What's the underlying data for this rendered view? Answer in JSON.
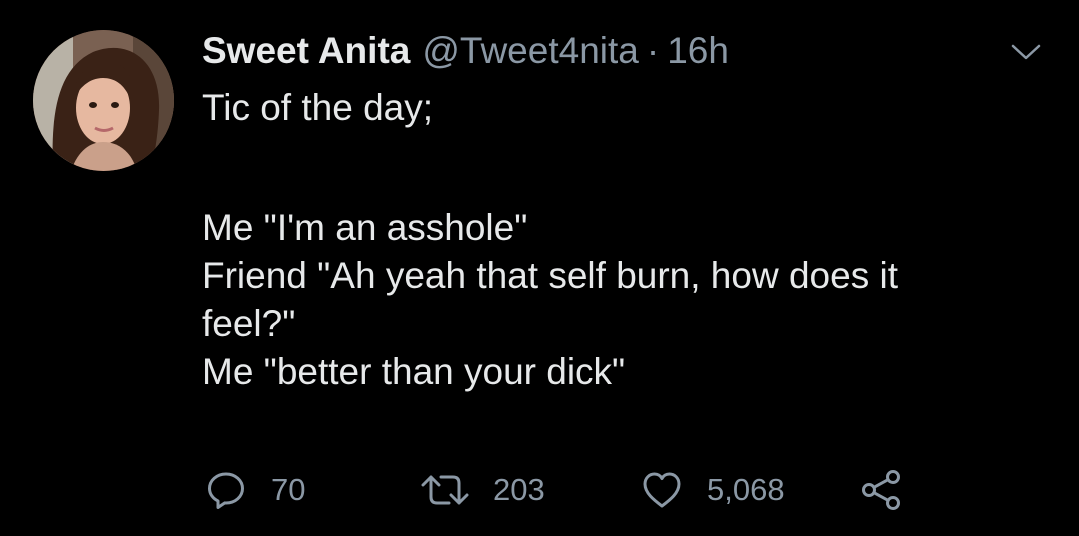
{
  "author": {
    "display_name": "Sweet Anita",
    "handle": "@Tweet4nita",
    "separator": "·",
    "time": "16h"
  },
  "tweet": {
    "lines": [
      "Tic of the day;",
      "",
      "Me \"I'm an asshole\"",
      "Friend \"Ah yeah that self burn, how does it",
      "feel?\"",
      "Me \"better than your dick\""
    ]
  },
  "actions": {
    "reply_count": "70",
    "retweet_count": "203",
    "like_count": "5,068"
  },
  "icons": {
    "reply": "reply-icon",
    "retweet": "retweet-icon",
    "like": "heart-icon",
    "share": "share-icon",
    "menu": "chevron-down-icon"
  },
  "colors": {
    "background": "#000000",
    "primary_text": "#e7e9ea",
    "secondary_text": "#8b98a5"
  }
}
